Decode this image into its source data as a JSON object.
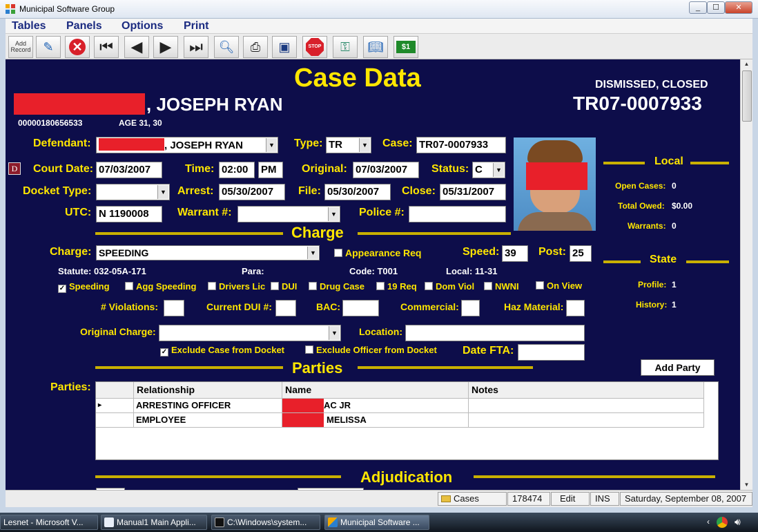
{
  "window": {
    "title": "Municipal Software Group"
  },
  "menu": [
    "Tables",
    "Panels",
    "Options",
    "Print"
  ],
  "toolbar": [
    {
      "icon": "add-record-icon",
      "label": "Add Record"
    },
    {
      "icon": "edit-record-icon",
      "label": ""
    },
    {
      "icon": "delete-icon",
      "label": ""
    },
    {
      "icon": "first-record-icon",
      "label": ""
    },
    {
      "icon": "previous-record-icon",
      "label": ""
    },
    {
      "icon": "next-record-icon",
      "label": ""
    },
    {
      "icon": "last-record-icon",
      "label": ""
    },
    {
      "icon": "find-icon",
      "label": ""
    },
    {
      "icon": "printer-icon",
      "label": ""
    },
    {
      "icon": "save-icon",
      "label": ""
    },
    {
      "icon": "stop-icon",
      "label": "STOP"
    },
    {
      "icon": "key-icon",
      "label": ""
    },
    {
      "icon": "book-icon",
      "label": ""
    },
    {
      "icon": "money-icon",
      "label": "$1"
    }
  ],
  "case": {
    "heading": "Case Data",
    "status_line": "DISMISSED,  CLOSED",
    "case_number_big": "TR07-0007933",
    "name_suffix": ", JOSEPH RYAN",
    "id_number": "00000180656533",
    "age": "AGE  31, 30"
  },
  "form": {
    "defendant_label": "Defendant:",
    "defendant_value": ", JOSEPH RYAN",
    "type_label": "Type:",
    "type_value": "TR",
    "case_label": "Case:",
    "case_value": "TR07-0007933",
    "d_button": "D",
    "court_date_label": "Court Date:",
    "court_date_value": "07/03/2007",
    "time_label": "Time:",
    "time_value": "02:00",
    "ampm_value": "PM",
    "original_label": "Original:",
    "original_value": "07/03/2007",
    "status_label": "Status:",
    "status_value": "C",
    "docket_type_label": "Docket Type:",
    "docket_type_value": "",
    "arrest_label": "Arrest:",
    "arrest_value": "05/30/2007",
    "file_label": "File:",
    "file_value": "05/30/2007",
    "close_label": "Close:",
    "close_value": "05/31/2007",
    "utc_label": "UTC:",
    "utc_value": "N 1190008",
    "warrant_label": "Warrant #:",
    "warrant_value": "",
    "police_label": "Police #:",
    "police_value": ""
  },
  "charge": {
    "section_title": "Charge",
    "charge_label": "Charge:",
    "charge_value": "SPEEDING",
    "appearance_req_label": "Appearance Req",
    "appearance_req_checked": false,
    "speed_label": "Speed:",
    "speed_value": "39",
    "post_label": "Post:",
    "post_value": "25",
    "statute_text": "Statute: 032-05A-171",
    "para_text": "Para:",
    "code_text": "Code:  T001",
    "local_text": "Local:  11-31",
    "checkboxes": [
      {
        "label": "Speeding",
        "checked": true
      },
      {
        "label": "Agg Speeding",
        "checked": false
      },
      {
        "label": "Drivers Lic",
        "checked": false
      },
      {
        "label": "DUI",
        "checked": false
      },
      {
        "label": "Drug Case",
        "checked": false
      },
      {
        "label": "19 Req",
        "checked": false
      },
      {
        "label": "Dom Viol",
        "checked": false
      },
      {
        "label": "NWNI",
        "checked": false
      },
      {
        "label": "On View",
        "checked": false
      }
    ],
    "violations_label": "# Violations:",
    "current_dui_label": "Current DUI #:",
    "bac_label": "BAC:",
    "commercial_label": "Commercial:",
    "haz_label": "Haz Material:",
    "original_charge_label": "Original Charge:",
    "original_charge_value": "",
    "location_label": "Location:",
    "location_value": "",
    "exclude_case_label": "Exclude Case from Docket",
    "exclude_case_checked": true,
    "exclude_officer_label": "Exclude Officer from Docket",
    "exclude_officer_checked": false,
    "date_fta_label": "Date FTA:",
    "date_fta_value": ""
  },
  "parties": {
    "section_title": "Parties",
    "label": "Parties:",
    "add_button": "Add Party",
    "columns": [
      "Relationship",
      "Name",
      "Notes"
    ],
    "rows": [
      {
        "relationship": "ARRESTING OFFICER",
        "name": "AC JR",
        "notes": "",
        "selected": true
      },
      {
        "relationship": "EMPLOYEE",
        "name": "MELISSA",
        "notes": "",
        "selected": false
      }
    ]
  },
  "adjudication": {
    "section_title": "Adjudication"
  },
  "sidebar": {
    "local_title": "Local",
    "open_cases_label": "Open Cases:",
    "open_cases_value": "0",
    "total_owed_label": "Total Owed:",
    "total_owed_value": "$0.00",
    "warrants_label": "Warrants:",
    "warrants_value": "0",
    "state_title": "State",
    "profile_label": "Profile:",
    "profile_value": "1",
    "history_label": "History:",
    "history_value": "1"
  },
  "statusbar": {
    "cases": "Cases",
    "record": "178474",
    "mode": "Edit",
    "ins": "INS",
    "date": "Saturday, September 08, 2007"
  },
  "taskbar": [
    {
      "label": "Lesnet - Microsoft V...",
      "active": false
    },
    {
      "label": "Manual1 Main Appli...",
      "active": false
    },
    {
      "label": "C:\\Windows\\system...",
      "active": false
    },
    {
      "label": "Municipal Software ...",
      "active": true
    }
  ],
  "colors": {
    "panel_bg": "#0d0d4a",
    "label_yellow": "#ffe600",
    "redaction": "#e8202a"
  }
}
